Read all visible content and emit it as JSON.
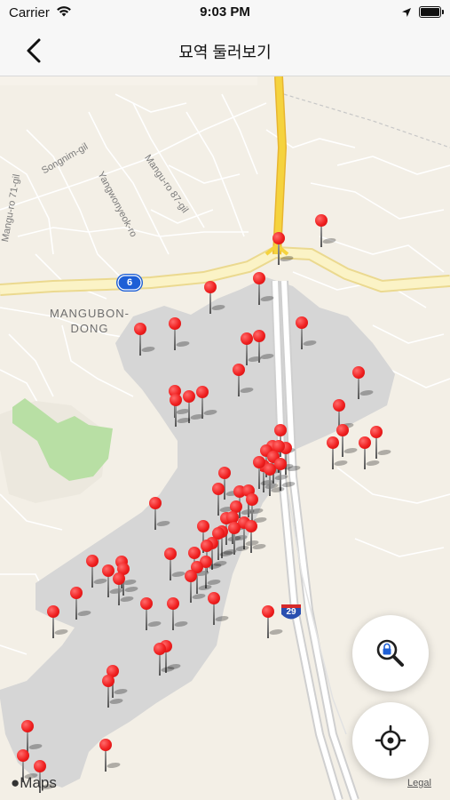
{
  "status_bar": {
    "carrier": "Carrier",
    "time": "9:03 PM"
  },
  "nav": {
    "title": "묘역 둘러보기",
    "back_icon": "chevron-left-icon"
  },
  "map": {
    "street_labels": [
      "Songnim-gil",
      "Yangwonyeok-ro",
      "Mangu-ro 87-gil",
      "Mangu-ro 71-gil"
    ],
    "district_label": [
      "MANGUBON-",
      "DONG"
    ],
    "route_shields": [
      "6",
      "29"
    ],
    "pin_count": 70,
    "attribution": "Maps",
    "legal_link": "Legal"
  },
  "controls": {
    "search_icon": "lock-magnifier-icon",
    "locate_icon": "crosshair-icon"
  },
  "colors": {
    "pin": "#f02020",
    "major_road": "#f5d33e",
    "arterial_road": "#fbf3c6",
    "cemetery_area": "#d6d6d6",
    "park": "#b8dfa4",
    "land": "#f3efe6",
    "accent_blue": "#1e5fd6"
  }
}
